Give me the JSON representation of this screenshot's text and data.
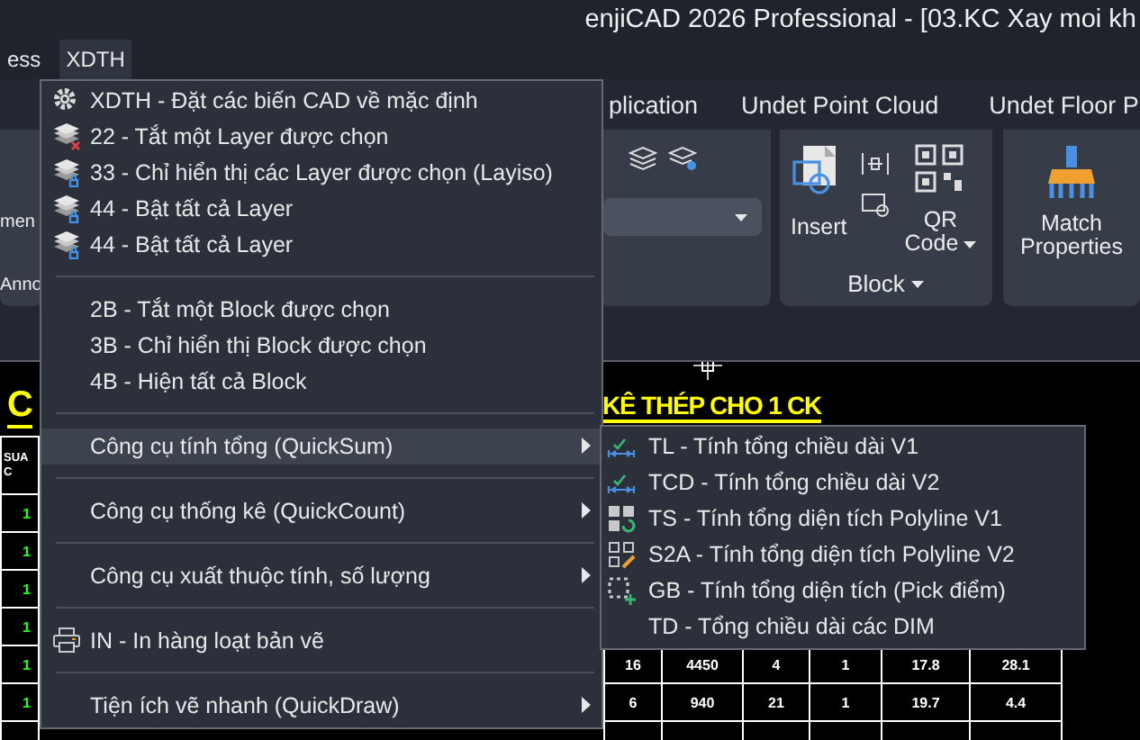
{
  "window": {
    "title": "enjiCAD 2026 Professional - [03.KC Xay moi kh"
  },
  "menu_bar": [
    {
      "label": "ess",
      "selected": false
    },
    {
      "label": "XDTH",
      "selected": true
    }
  ],
  "ribbon": {
    "tabs": [
      "plication",
      "Undet Point Cloud",
      "Undet Floor P"
    ],
    "left_texts": [
      "men",
      "Anno"
    ],
    "insert_button": "Insert",
    "qr_button": [
      "QR",
      "Code"
    ],
    "block_panel_title": "Block",
    "match_button": [
      "Match",
      "Properties"
    ]
  },
  "drawing": {
    "titles": [
      "C",
      "KÊ THÉP CHO 1 CK"
    ],
    "table": {
      "column_1_heading": "SUA C",
      "rows": [
        {
          "cells": [
            "1"
          ]
        },
        {
          "cells": [
            "1"
          ]
        },
        {
          "cells": [
            "1"
          ]
        },
        {
          "cells": [
            "1"
          ]
        },
        {
          "cells": [
            "1",
            "16",
            "4450",
            "4",
            "1",
            "17.8",
            "28.1"
          ]
        },
        {
          "cells": [
            "1",
            "6",
            "940",
            "21",
            "1",
            "19.7",
            "4.4"
          ]
        }
      ]
    }
  },
  "xdth_menu": {
    "groups": [
      [
        {
          "kind": "command",
          "label": "XDTH - Đặt các biến CAD về mặc định",
          "selected": false
        },
        {
          "kind": "command",
          "label": "22 - Tắt một Layer được chọn",
          "selected": false
        },
        {
          "kind": "command",
          "label": "33 - Chỉ hiển thị các Layer được chọn (Layiso)",
          "selected": false
        },
        {
          "kind": "command",
          "label": "44 - Bật tất cả Layer",
          "selected": false
        },
        {
          "kind": "command",
          "label": "44 - Bật tất cả Layer",
          "selected": false
        }
      ],
      [
        {
          "kind": "command",
          "label": "2B - Tắt một Block được chọn",
          "selected": false
        },
        {
          "kind": "command",
          "label": "3B - Chỉ hiển thị Block được chọn",
          "selected": false
        },
        {
          "kind": "command",
          "label": "4B - Hiện tất cả Block",
          "selected": false
        }
      ],
      [
        {
          "kind": "submenu",
          "label": "Công cụ tính tổng (QuickSum)",
          "selected": true,
          "submenu": [
            {
              "label": "TL - Tính tổng chiều dài V1",
              "selected": false
            },
            {
              "label": "TCD - Tính tổng chiều dài V2",
              "selected": false
            },
            {
              "label": "TS - Tính tổng diện tích Polyline V1",
              "selected": false
            },
            {
              "label": "S2A - Tính tổng diện tích Polyline V2",
              "selected": false
            },
            {
              "label": "GB - Tính tổng diện tích (Pick điểm)",
              "selected": false
            },
            {
              "label": "TD - Tổng chiều dài các DIM",
              "selected": false
            }
          ]
        }
      ],
      [
        {
          "kind": "submenu",
          "label": "Công cụ thống kê (QuickCount)",
          "selected": false
        }
      ],
      [
        {
          "kind": "submenu",
          "label": "Công cụ xuất thuộc tính, số lượng",
          "selected": false
        }
      ],
      [
        {
          "kind": "command",
          "label": "IN - In hàng loạt bản vẽ",
          "selected": false
        }
      ],
      [
        {
          "kind": "submenu",
          "label": "Tiện ích vẽ nhanh (QuickDraw)",
          "selected": false
        }
      ]
    ]
  }
}
